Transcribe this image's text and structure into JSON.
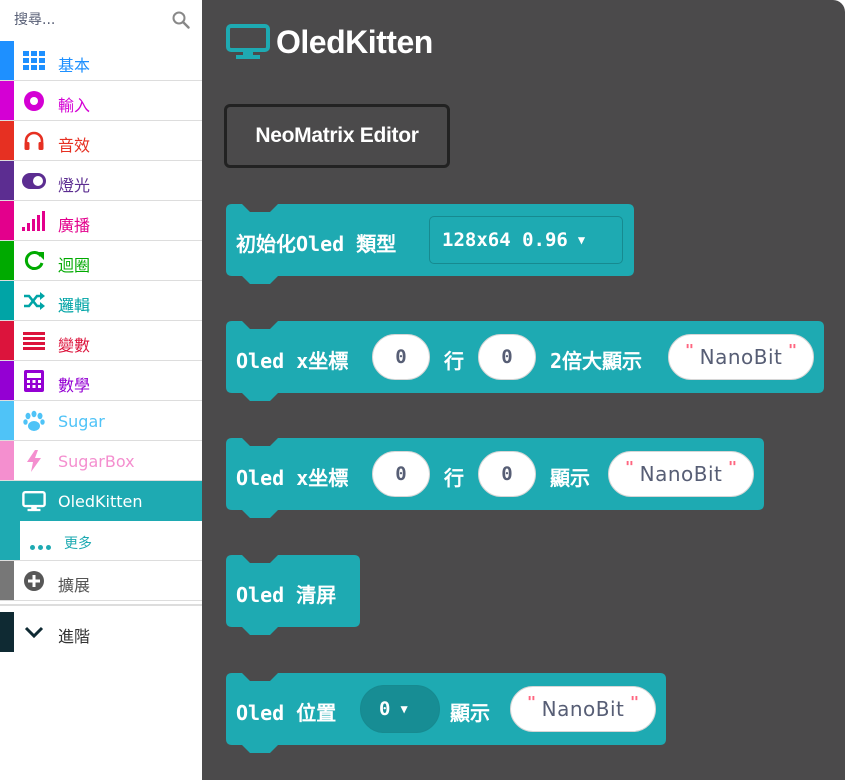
{
  "search": {
    "placeholder": "搜尋..."
  },
  "categories": [
    {
      "label": "基本",
      "color": "#1e90ff",
      "icon": "grid-icon"
    },
    {
      "label": "輸入",
      "color": "#d400d4",
      "icon": "circle-dot-icon"
    },
    {
      "label": "音效",
      "color": "#e63022",
      "icon": "headphones-icon"
    },
    {
      "label": "燈光",
      "color": "#5c2d91",
      "icon": "toggle-icon"
    },
    {
      "label": "廣播",
      "color": "#e3008c",
      "icon": "signal-bars-icon"
    },
    {
      "label": "迴圈",
      "color": "#00aa00",
      "icon": "refresh-icon"
    },
    {
      "label": "邏輯",
      "color": "#00a4a6",
      "icon": "shuffle-icon"
    },
    {
      "label": "變數",
      "color": "#dc143c",
      "icon": "list-lines-icon"
    },
    {
      "label": "數學",
      "color": "#9400d3",
      "icon": "calculator-icon"
    },
    {
      "label": "Sugar",
      "color": "#4fc3f7",
      "icon": "paw-icon"
    },
    {
      "label": "SugarBox",
      "color": "#f48fcf",
      "icon": "lightning-icon"
    },
    {
      "label": "OledKitten",
      "color": "#1eaab2",
      "icon": "monitor-icon"
    }
  ],
  "more": {
    "label": "更多"
  },
  "extensions": {
    "label": "擴展",
    "color": "#777777",
    "icon": "plus-circle-icon"
  },
  "advanced": {
    "label": "進階",
    "color": "#0f2a33",
    "icon": "chevron-down-icon"
  },
  "flyout": {
    "title": "OledKitten",
    "editor_button": "NeoMatrix Editor",
    "block_color": "#1eaab2",
    "blocks": {
      "init": {
        "text": "初始化Oled 類型",
        "dropdown": "128x64 0.96"
      },
      "show2x": {
        "t1": "Oled x坐標",
        "x": "0",
        "t2": "行",
        "y": "0",
        "t3": "2倍大顯示",
        "str": "NanoBit"
      },
      "show": {
        "t1": "Oled x坐標",
        "x": "0",
        "t2": "行",
        "y": "0",
        "t3": "顯示",
        "str": "NanoBit"
      },
      "clear": {
        "text": "Oled 清屏"
      },
      "pos": {
        "t1": "Oled 位置",
        "val": "0",
        "t2": "顯示",
        "str": "NanoBit"
      }
    }
  }
}
